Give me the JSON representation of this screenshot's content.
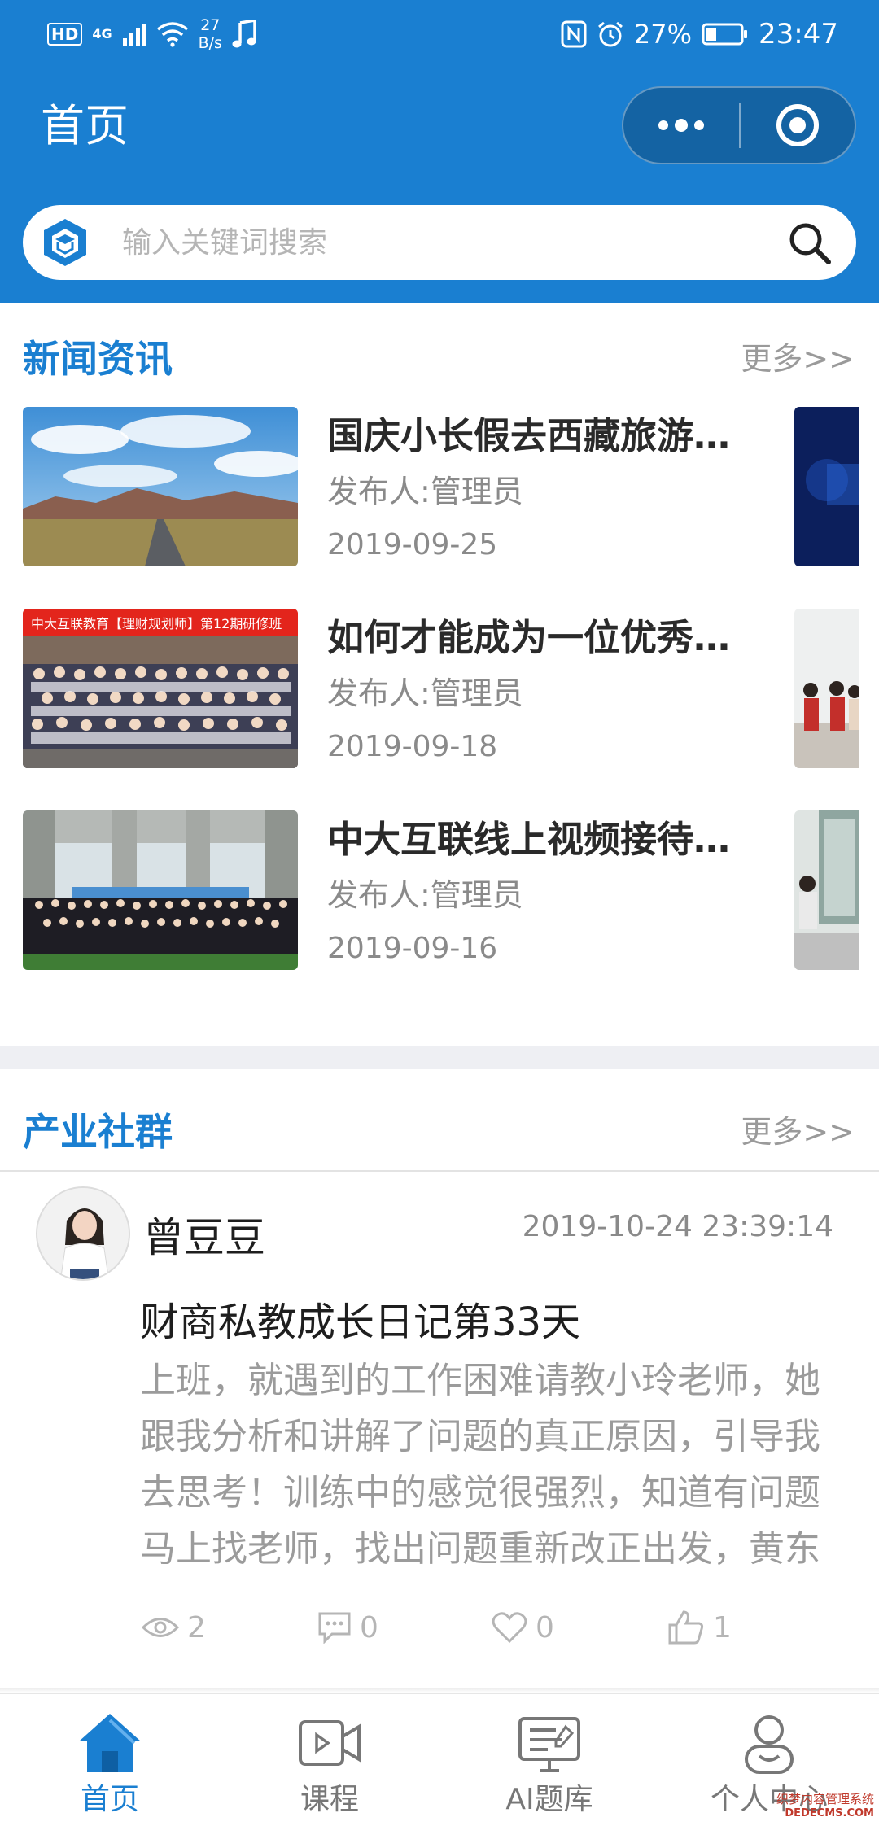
{
  "status_bar": {
    "hd_label": "HD",
    "network_label": "4G",
    "speed_value": "27",
    "speed_unit": "B/s",
    "battery_text": "27%",
    "time": "23:47"
  },
  "header": {
    "title": "首页",
    "accent_color": "#1a7fd1"
  },
  "search": {
    "placeholder": "输入关键词搜索"
  },
  "news": {
    "title": "新闻资讯",
    "more_label": "更多>>",
    "items": [
      {
        "title": "国庆小长假去西藏旅游…",
        "author": "发布人:管理员",
        "date": "2019-09-25",
        "thumb": "landscape-road-photo"
      },
      {
        "title": "如何才能成为一位优秀…",
        "author": "发布人:管理员",
        "date": "2019-09-18",
        "thumb": "group-photo",
        "banner": "中大互联教育【理财规划师】第12期研修班"
      },
      {
        "title": "中大互联线上视频接待…",
        "author": "发布人:管理员",
        "date": "2019-09-16",
        "thumb": "graduation-group-photo"
      }
    ]
  },
  "community": {
    "title": "产业社群",
    "more_label": "更多>>",
    "post": {
      "user": "曾豆豆",
      "time": "2019-10-24 23:39:14",
      "title": "财商私教成长日记第33天",
      "body": "上班，就遇到的工作困难请教小玲老师，她跟我分析和讲解了问题的真正原因，引导我去思考！训练中的感觉很强烈，知道有问题马上找老师，找出问题重新改正出发，黄东",
      "views": "2",
      "comments": "0",
      "likes": "0",
      "thumbs": "1"
    }
  },
  "tabbar": {
    "items": [
      {
        "label": "首页",
        "icon": "home-icon",
        "active": true
      },
      {
        "label": "课程",
        "icon": "video-icon",
        "active": false
      },
      {
        "label": "AI题库",
        "icon": "monitor-icon",
        "active": false
      },
      {
        "label": "个人中心",
        "icon": "user-icon",
        "active": false
      }
    ]
  },
  "watermark": {
    "cn": "织梦内容管理系统",
    "en": "DEDECMS.COM"
  }
}
